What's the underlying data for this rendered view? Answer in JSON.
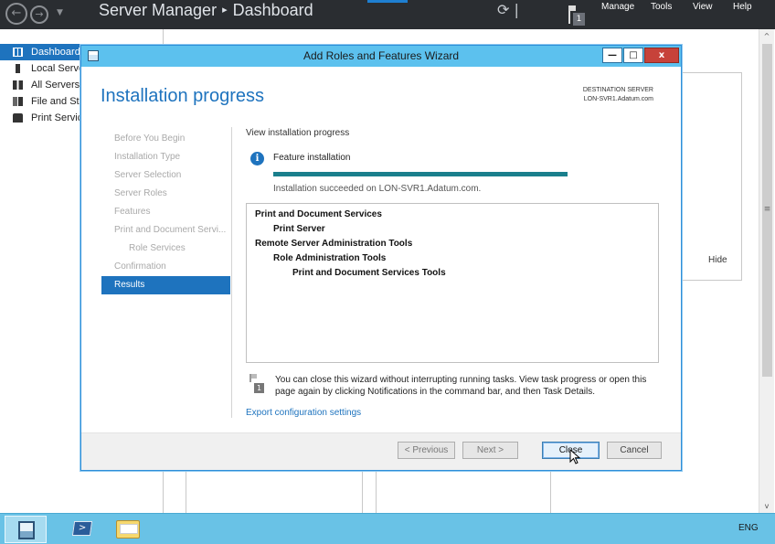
{
  "server_manager": {
    "title": "Server Manager",
    "breadcrumb_separator": "▸",
    "page": "Dashboard",
    "refresh_glyph": "⟳ |",
    "notification_count": "1",
    "menu": [
      "Manage",
      "Tools",
      "View",
      "Help"
    ]
  },
  "left_nav": {
    "items": [
      {
        "label": "Dashboard",
        "icon": "dashboard-icon"
      },
      {
        "label": "Local Server",
        "icon": "server-icon"
      },
      {
        "label": "All Servers",
        "icon": "servers-icon"
      },
      {
        "label": "File and Storage Services",
        "icon": "file-storage-icon"
      },
      {
        "label": "Print Services",
        "icon": "printer-icon"
      }
    ]
  },
  "background": {
    "hide_label": "Hide"
  },
  "wizard": {
    "title": "Add Roles and Features Wizard",
    "heading": "Installation progress",
    "destination_label": "DESTINATION SERVER",
    "destination_server": "LON-SVR1.Adatum.com",
    "steps": [
      {
        "label": "Before You Begin"
      },
      {
        "label": "Installation Type"
      },
      {
        "label": "Server Selection"
      },
      {
        "label": "Server Roles"
      },
      {
        "label": "Features"
      },
      {
        "label": "Print and Document Servi..."
      },
      {
        "label": "Role Services"
      },
      {
        "label": "Confirmation"
      },
      {
        "label": "Results"
      }
    ],
    "view_label": "View installation progress",
    "feature_label": "Feature installation",
    "progress_percent": 100,
    "success_text": "Installation succeeded on LON-SVR1.Adatum.com.",
    "results": [
      "Print and Document Services",
      "Print Server",
      "Remote Server Administration Tools",
      "Role Administration Tools",
      "Print and Document Services Tools"
    ],
    "note": "You can close this wizard without interrupting running tasks. View task progress or open this page again by clicking Notifications in the command bar, and then Task Details.",
    "note_badge": "1",
    "export_link": "Export configuration settings",
    "buttons": {
      "previous": "< Previous",
      "next": "Next >",
      "close": "Close",
      "cancel": "Cancel"
    }
  },
  "taskbar": {
    "language": "ENG"
  },
  "colors": {
    "accent": "#1e73be",
    "titlebar": "#5cc1ee",
    "progress": "#1a7f8c",
    "taskbar": "#69c2e6"
  }
}
